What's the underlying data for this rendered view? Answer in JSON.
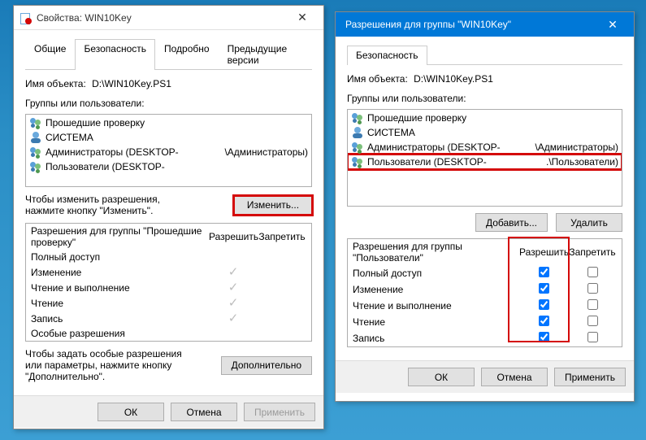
{
  "left": {
    "title": "Свойства: WIN10Key",
    "tabs": [
      "Общие",
      "Безопасность",
      "Подробно",
      "Предыдущие версии"
    ],
    "active_tab": 1,
    "object_label": "Имя объекта:",
    "object_value": "D:\\WIN10Key.PS1",
    "groups_label": "Группы или пользователи:",
    "principals": [
      {
        "name": "Прошедшие проверку",
        "kind": "group"
      },
      {
        "name": "СИСТЕМА",
        "kind": "user"
      },
      {
        "name": "Администраторы (DESKTOP-",
        "suffix": "\\Администраторы)",
        "kind": "group"
      },
      {
        "name": "Пользователи (DESKTOP-",
        "suffix": "",
        "kind": "group"
      }
    ],
    "change_note": "Чтобы изменить разрешения, нажмите кнопку \"Изменить\".",
    "change_btn": "Изменить...",
    "perm_for_label": "Разрешения для группы \"Прошедшие проверку\"",
    "col_allow": "Разрешить",
    "col_deny": "Запретить",
    "perms": [
      {
        "name": "Полный доступ",
        "allow": false,
        "deny": false
      },
      {
        "name": "Изменение",
        "allow": true,
        "deny": false
      },
      {
        "name": "Чтение и выполнение",
        "allow": true,
        "deny": false
      },
      {
        "name": "Чтение",
        "allow": true,
        "deny": false
      },
      {
        "name": "Запись",
        "allow": true,
        "deny": false
      },
      {
        "name": "Особые разрешения",
        "allow": false,
        "deny": false
      }
    ],
    "adv_note": "Чтобы задать особые разрешения или параметры, нажмите кнопку \"Дополнительно\".",
    "adv_btn": "Дополнительно",
    "ok": "ОК",
    "cancel": "Отмена",
    "apply": "Применить"
  },
  "right": {
    "title": "Разрешения для группы \"WIN10Key\"",
    "tabs": [
      "Безопасность"
    ],
    "object_label": "Имя объекта:",
    "object_value": "D:\\WIN10Key.PS1",
    "groups_label": "Группы или пользователи:",
    "principals": [
      {
        "name": "Прошедшие проверку",
        "kind": "group"
      },
      {
        "name": "СИСТЕМА",
        "kind": "user"
      },
      {
        "name": "Администраторы (DESKTOP-",
        "suffix": "\\Администраторы)",
        "kind": "group"
      },
      {
        "name": "Пользователи (DESKTOP-",
        "suffix": ".\\Пользователи)",
        "kind": "group",
        "highlight": true
      }
    ],
    "add_btn": "Добавить...",
    "remove_btn": "Удалить",
    "perm_for_label": "Разрешения для группы \"Пользователи\"",
    "col_allow": "Разрешить",
    "col_deny": "Запретить",
    "perms": [
      {
        "name": "Полный доступ",
        "allow": true,
        "deny": false
      },
      {
        "name": "Изменение",
        "allow": true,
        "deny": false
      },
      {
        "name": "Чтение и выполнение",
        "allow": true,
        "deny": false
      },
      {
        "name": "Чтение",
        "allow": true,
        "deny": false
      },
      {
        "name": "Запись",
        "allow": true,
        "deny": false
      }
    ],
    "ok": "ОК",
    "cancel": "Отмена",
    "apply": "Применить"
  }
}
